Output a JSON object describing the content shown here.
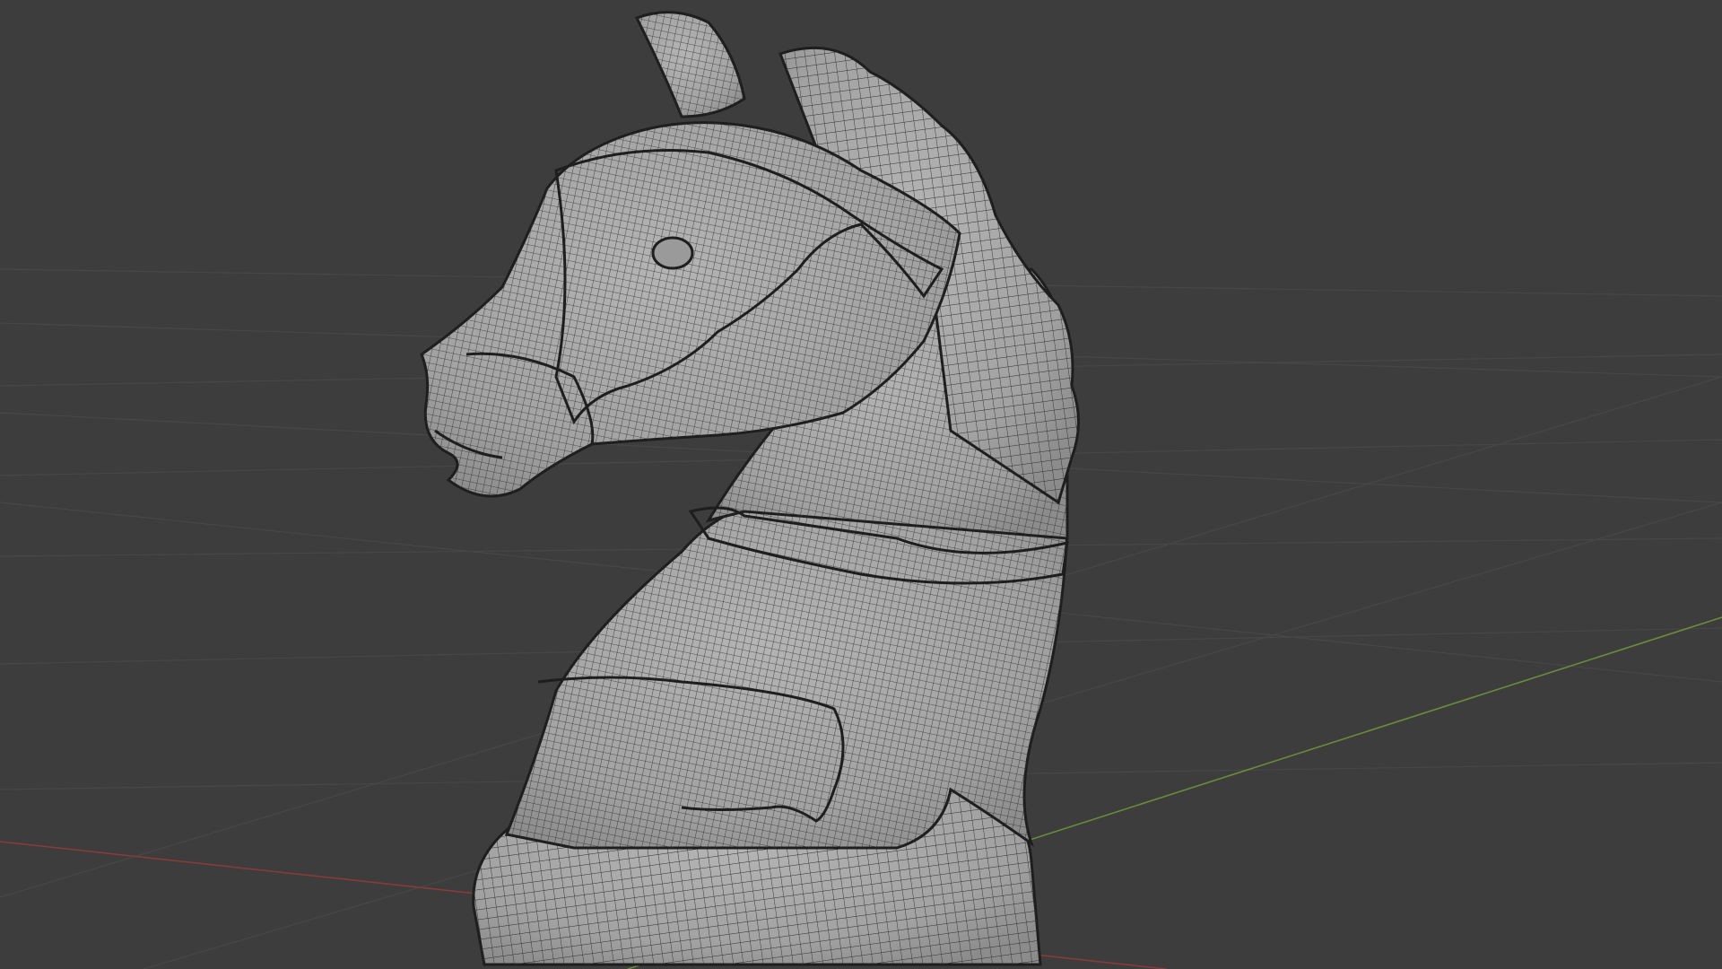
{
  "viewport": {
    "background_color": "#3d3d3d",
    "grid_color": "#4a4a4a",
    "x_axis_color": "#8a3a3a",
    "y_axis_color": "#6d8a3a",
    "shown_object": "chess-knight-mesh",
    "shading": "solid",
    "wireframe_overlay": true,
    "mesh_color": "#a8a8a8",
    "wire_color": "#2a2a2a"
  }
}
